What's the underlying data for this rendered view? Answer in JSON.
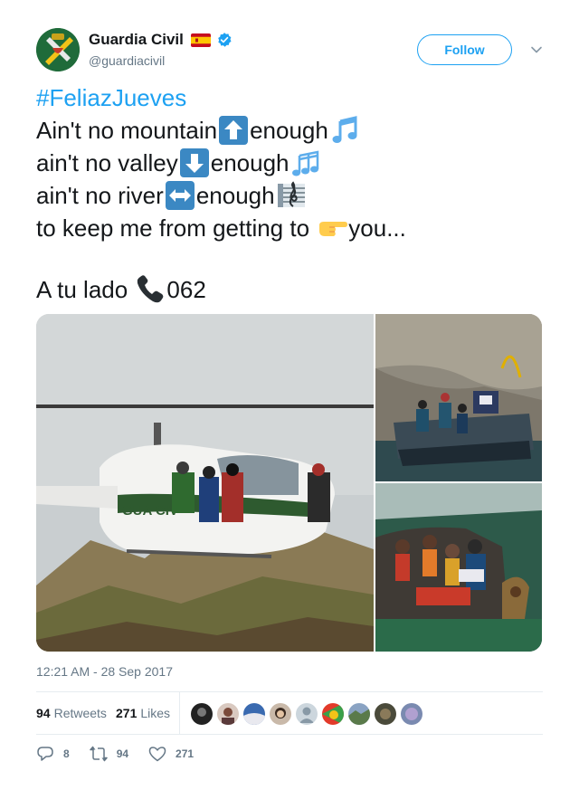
{
  "author": {
    "display_name": "Guardia Civil",
    "handle": "@guardiacivil",
    "flag_icon": "spain-flag-icon",
    "verified_icon": "verified-badge-icon",
    "avatar_icon": "guardia-civil-emblem"
  },
  "follow_button": {
    "label": "Follow"
  },
  "menu": {
    "icon": "chevron-down-icon"
  },
  "tweet": {
    "hashtag": "#FeliazJueves",
    "lines": [
      {
        "text": "Ain't no mountain",
        "emoji1": "up-arrow-button-icon",
        "text2": "enough",
        "emoji2": "musical-note-icon"
      },
      {
        "text": "ain't no valley",
        "emoji1": "down-arrow-button-icon",
        "text2": "enough",
        "emoji2": "musical-notes-icon"
      },
      {
        "text": "ain't no river",
        "emoji1": "left-right-arrow-button-icon",
        "text2": "enough",
        "emoji2": "musical-score-icon"
      },
      {
        "text": "to keep me from getting to ",
        "emoji1": "backhand-pointing-right-icon",
        "text2": "you..."
      }
    ],
    "closing_text": "A tu lado ",
    "closing_emoji": "telephone-receiver-icon",
    "closing_number": "062"
  },
  "media": [
    {
      "name": "helicopter-rescue-photo"
    },
    {
      "name": "boat-cliff-rescue-photo"
    },
    {
      "name": "boat-migrants-photo"
    }
  ],
  "timestamp": "12:21 AM - 28 Sep 2017",
  "stats": {
    "retweets_count": "94",
    "retweets_label": "Retweets",
    "likes_count": "271",
    "likes_label": "Likes",
    "liker_count": 9
  },
  "actions": {
    "reply_count": "8",
    "retweet_count": "94",
    "like_count": "271"
  },
  "colors": {
    "accent": "#1da1f2",
    "text": "#14171a",
    "muted": "#657786",
    "border": "#e6ecf0"
  }
}
